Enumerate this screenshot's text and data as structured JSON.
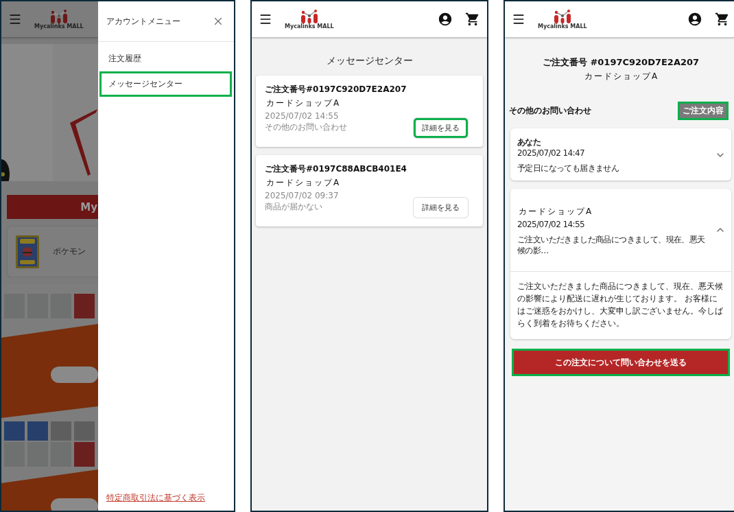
{
  "home_with_menu": {
    "header": {
      "brand": "Mycalinks MALL"
    },
    "hero_button": {
      "label": "My"
    },
    "category_card": {
      "label": "ポケモン"
    },
    "account_menu": {
      "title": "アカウントメニュー",
      "items": [
        {
          "label": "注文履歴",
          "highlighted": false
        },
        {
          "label": "メッセージセンター",
          "highlighted": true
        }
      ],
      "footer_link": "特定商取引法に基づく表示"
    }
  },
  "message_center": {
    "header": {
      "brand": "Mycalinks MALL"
    },
    "title": "メッセージセンター",
    "messages": [
      {
        "order": "ご注文番号#0197C920D7E2A207",
        "shop": "カードショップA",
        "date": "2025/07/02 14:55",
        "subject": "その他のお問い合わせ",
        "button": "詳細を見る",
        "highlighted": true
      },
      {
        "order": "ご注文番号#0197C88ABCB401E4",
        "shop": "カードショップA",
        "date": "2025/07/02 09:37",
        "subject": "商品が届かない",
        "button": "詳細を見る",
        "highlighted": false
      }
    ]
  },
  "message_detail": {
    "header": {
      "brand": "Mycalinks MALL"
    },
    "order": "ご注文番号 #0197C920D7E2A207",
    "shop": "カードショップA",
    "category": "その他のお問い合わせ",
    "order_button": {
      "label": "ご注文内容",
      "highlighted": true
    },
    "thread": [
      {
        "sender": "あなた",
        "date": "2025/07/02 14:47",
        "preview": "予定日になっても届きません",
        "expanded": false
      },
      {
        "sender": "カードショップA",
        "date": "2025/07/02 14:55",
        "preview": "ご注文いただきました商品につきまして、現在、悪天候の影…",
        "body": "ご注文いただきました商品につきまして、現在、悪天候の影響により配送に遅れが生じております。 お客様にはご迷惑をおかけし、大変申し訳ございません。今しばらく到着をお待ちください。",
        "expanded": true
      }
    ],
    "send_button": {
      "label": "この注文について問い合わせを送る",
      "highlighted": true
    }
  }
}
